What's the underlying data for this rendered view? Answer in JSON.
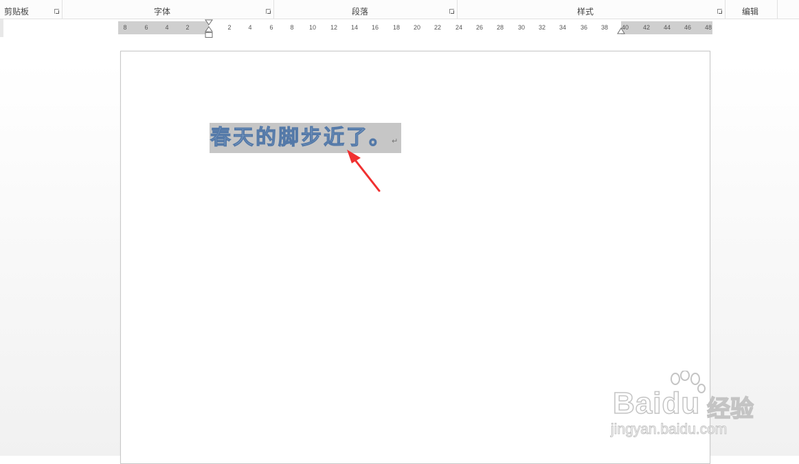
{
  "ribbon": {
    "groups": [
      {
        "label": "剪贴板",
        "has_launcher": true
      },
      {
        "label": "字体",
        "has_launcher": true
      },
      {
        "label": "段落",
        "has_launcher": true
      },
      {
        "label": "样式",
        "has_launcher": true
      },
      {
        "label": "编辑",
        "has_launcher": false
      }
    ]
  },
  "ruler": {
    "left_labels": [
      "8",
      "6",
      "4",
      "2"
    ],
    "right_labels": [
      "2",
      "4",
      "6",
      "8",
      "10",
      "12",
      "14",
      "16",
      "18",
      "20",
      "22",
      "24",
      "26",
      "28",
      "30",
      "32",
      "34",
      "36",
      "38",
      "40",
      "42",
      "44",
      "46",
      "48"
    ]
  },
  "document": {
    "text": "春天的脚步近了。",
    "paragraph_mark": "↵",
    "text_fill_color": "#a9c2de",
    "text_outline_color": "#5479a8",
    "selection_color": "#c6c6c6"
  },
  "annotation": {
    "arrow_color": "#f03030"
  },
  "watermark": {
    "brand": "Baidu",
    "brand_cn": "经验",
    "url": "jingyan.baidu.com"
  }
}
